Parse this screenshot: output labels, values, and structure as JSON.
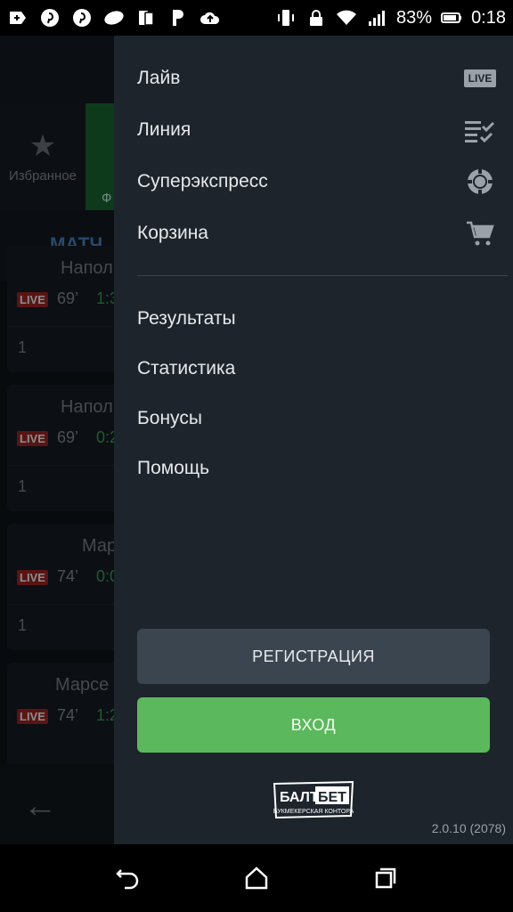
{
  "status_bar": {
    "battery": "83%",
    "time": "0:18"
  },
  "background": {
    "favorites_label": "Избранное",
    "green_tab_label": "Ф",
    "active_tab": "МАТЧ",
    "cards": [
      {
        "title": "Напол",
        "live": "LIVE",
        "minute": "69’",
        "score": "1:3",
        "odds": "1"
      },
      {
        "title": "Напол",
        "live": "LIVE",
        "minute": "69’",
        "score": "0:2",
        "odds": "1"
      },
      {
        "title": "Мар",
        "live": "LIVE",
        "minute": "74’",
        "score": "0:0",
        "odds": "1"
      },
      {
        "title": "Марсе",
        "live": "LIVE",
        "minute": "74’",
        "score": "1:2",
        "odds": ""
      }
    ]
  },
  "drawer": {
    "primary_items": [
      {
        "label": "Лайв",
        "icon": "live-icon",
        "badge": "LIVE"
      },
      {
        "label": "Линия",
        "icon": "checklist-icon"
      },
      {
        "label": "Суперэкспресс",
        "icon": "chip-icon"
      },
      {
        "label": "Корзина",
        "icon": "cart-icon"
      }
    ],
    "secondary_items": [
      {
        "label": "Результаты"
      },
      {
        "label": "Статистика"
      },
      {
        "label": "Бонусы"
      },
      {
        "label": "Помощь"
      }
    ],
    "register_label": "РЕГИСТРАЦИЯ",
    "login_label": "ВХОД",
    "logo": {
      "line1_left": "БАЛТ",
      "line1_right": "БЕТ",
      "line2": "БУКМЕКЕРСКАЯ КОНТОРА"
    },
    "version": "2.0.10 (2078)"
  },
  "colors": {
    "drawer_bg": "#1d242c",
    "login_green": "#5cb85c",
    "register_gray": "#3b4550",
    "live_red": "#a42525"
  }
}
